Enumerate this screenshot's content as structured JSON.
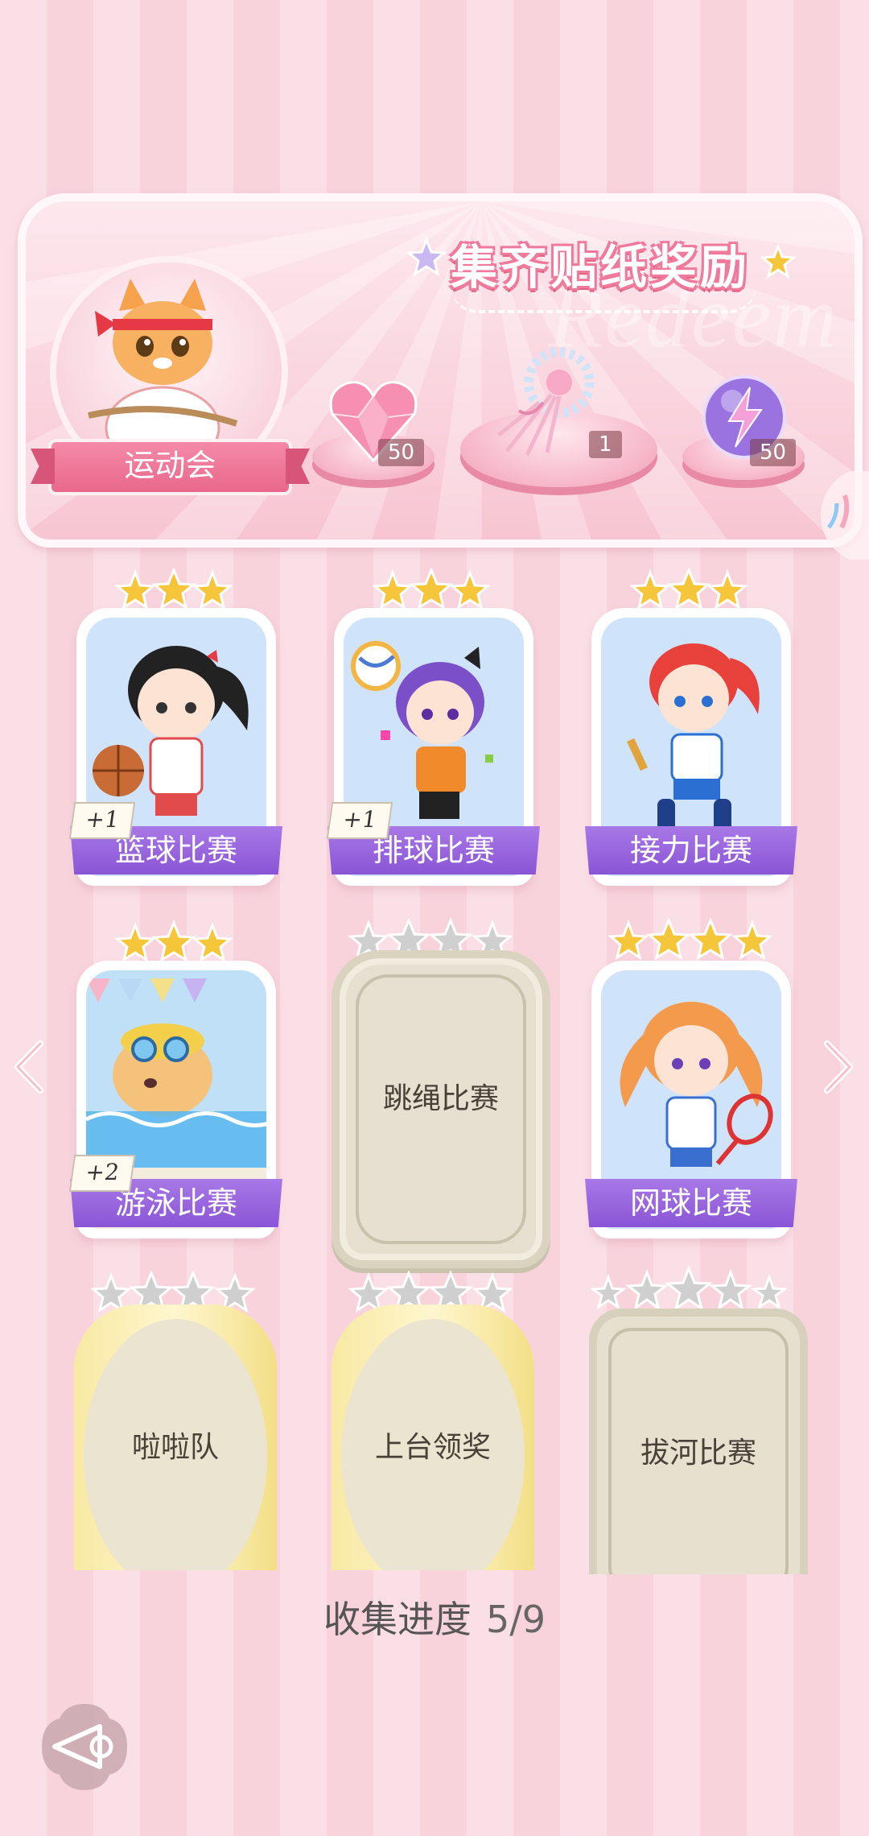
{
  "banner": {
    "title": "集齐贴纸奖励",
    "watermark": "Redeem",
    "event_label": "运动会",
    "rewards": [
      {
        "icon": "pink-heart-gem-icon",
        "count": "50"
      },
      {
        "icon": "ribbon-bouquet-icon",
        "count": "1"
      },
      {
        "icon": "lightning-orb-icon",
        "count": "50"
      }
    ]
  },
  "cards": [
    {
      "label": "篮球比赛",
      "stars": 3,
      "unlocked": true,
      "bonus": "+1"
    },
    {
      "label": "排球比赛",
      "stars": 3,
      "unlocked": true,
      "bonus": "+1"
    },
    {
      "label": "接力比赛",
      "stars": 3,
      "unlocked": true,
      "bonus": ""
    },
    {
      "label": "游泳比赛",
      "stars": 3,
      "unlocked": true,
      "bonus": "+2"
    },
    {
      "label": "跳绳比赛",
      "stars": 4,
      "unlocked": false,
      "bonus": ""
    },
    {
      "label": "网球比赛",
      "stars": 4,
      "unlocked": true,
      "bonus": ""
    },
    {
      "label": "啦啦队",
      "stars": 4,
      "unlocked": false,
      "bonus": ""
    },
    {
      "label": "上台领奖",
      "stars": 4,
      "unlocked": false,
      "bonus": ""
    },
    {
      "label": "拔河比赛",
      "stars": 5,
      "unlocked": false,
      "bonus": ""
    }
  ],
  "progress": {
    "label": "收集进度",
    "value": "5/9"
  },
  "colors": {
    "accent_pink": "#f07a9c",
    "band_purple": "#8a55d6",
    "star_gold": "#f5c53a",
    "star_gray": "#c9c9c9"
  }
}
